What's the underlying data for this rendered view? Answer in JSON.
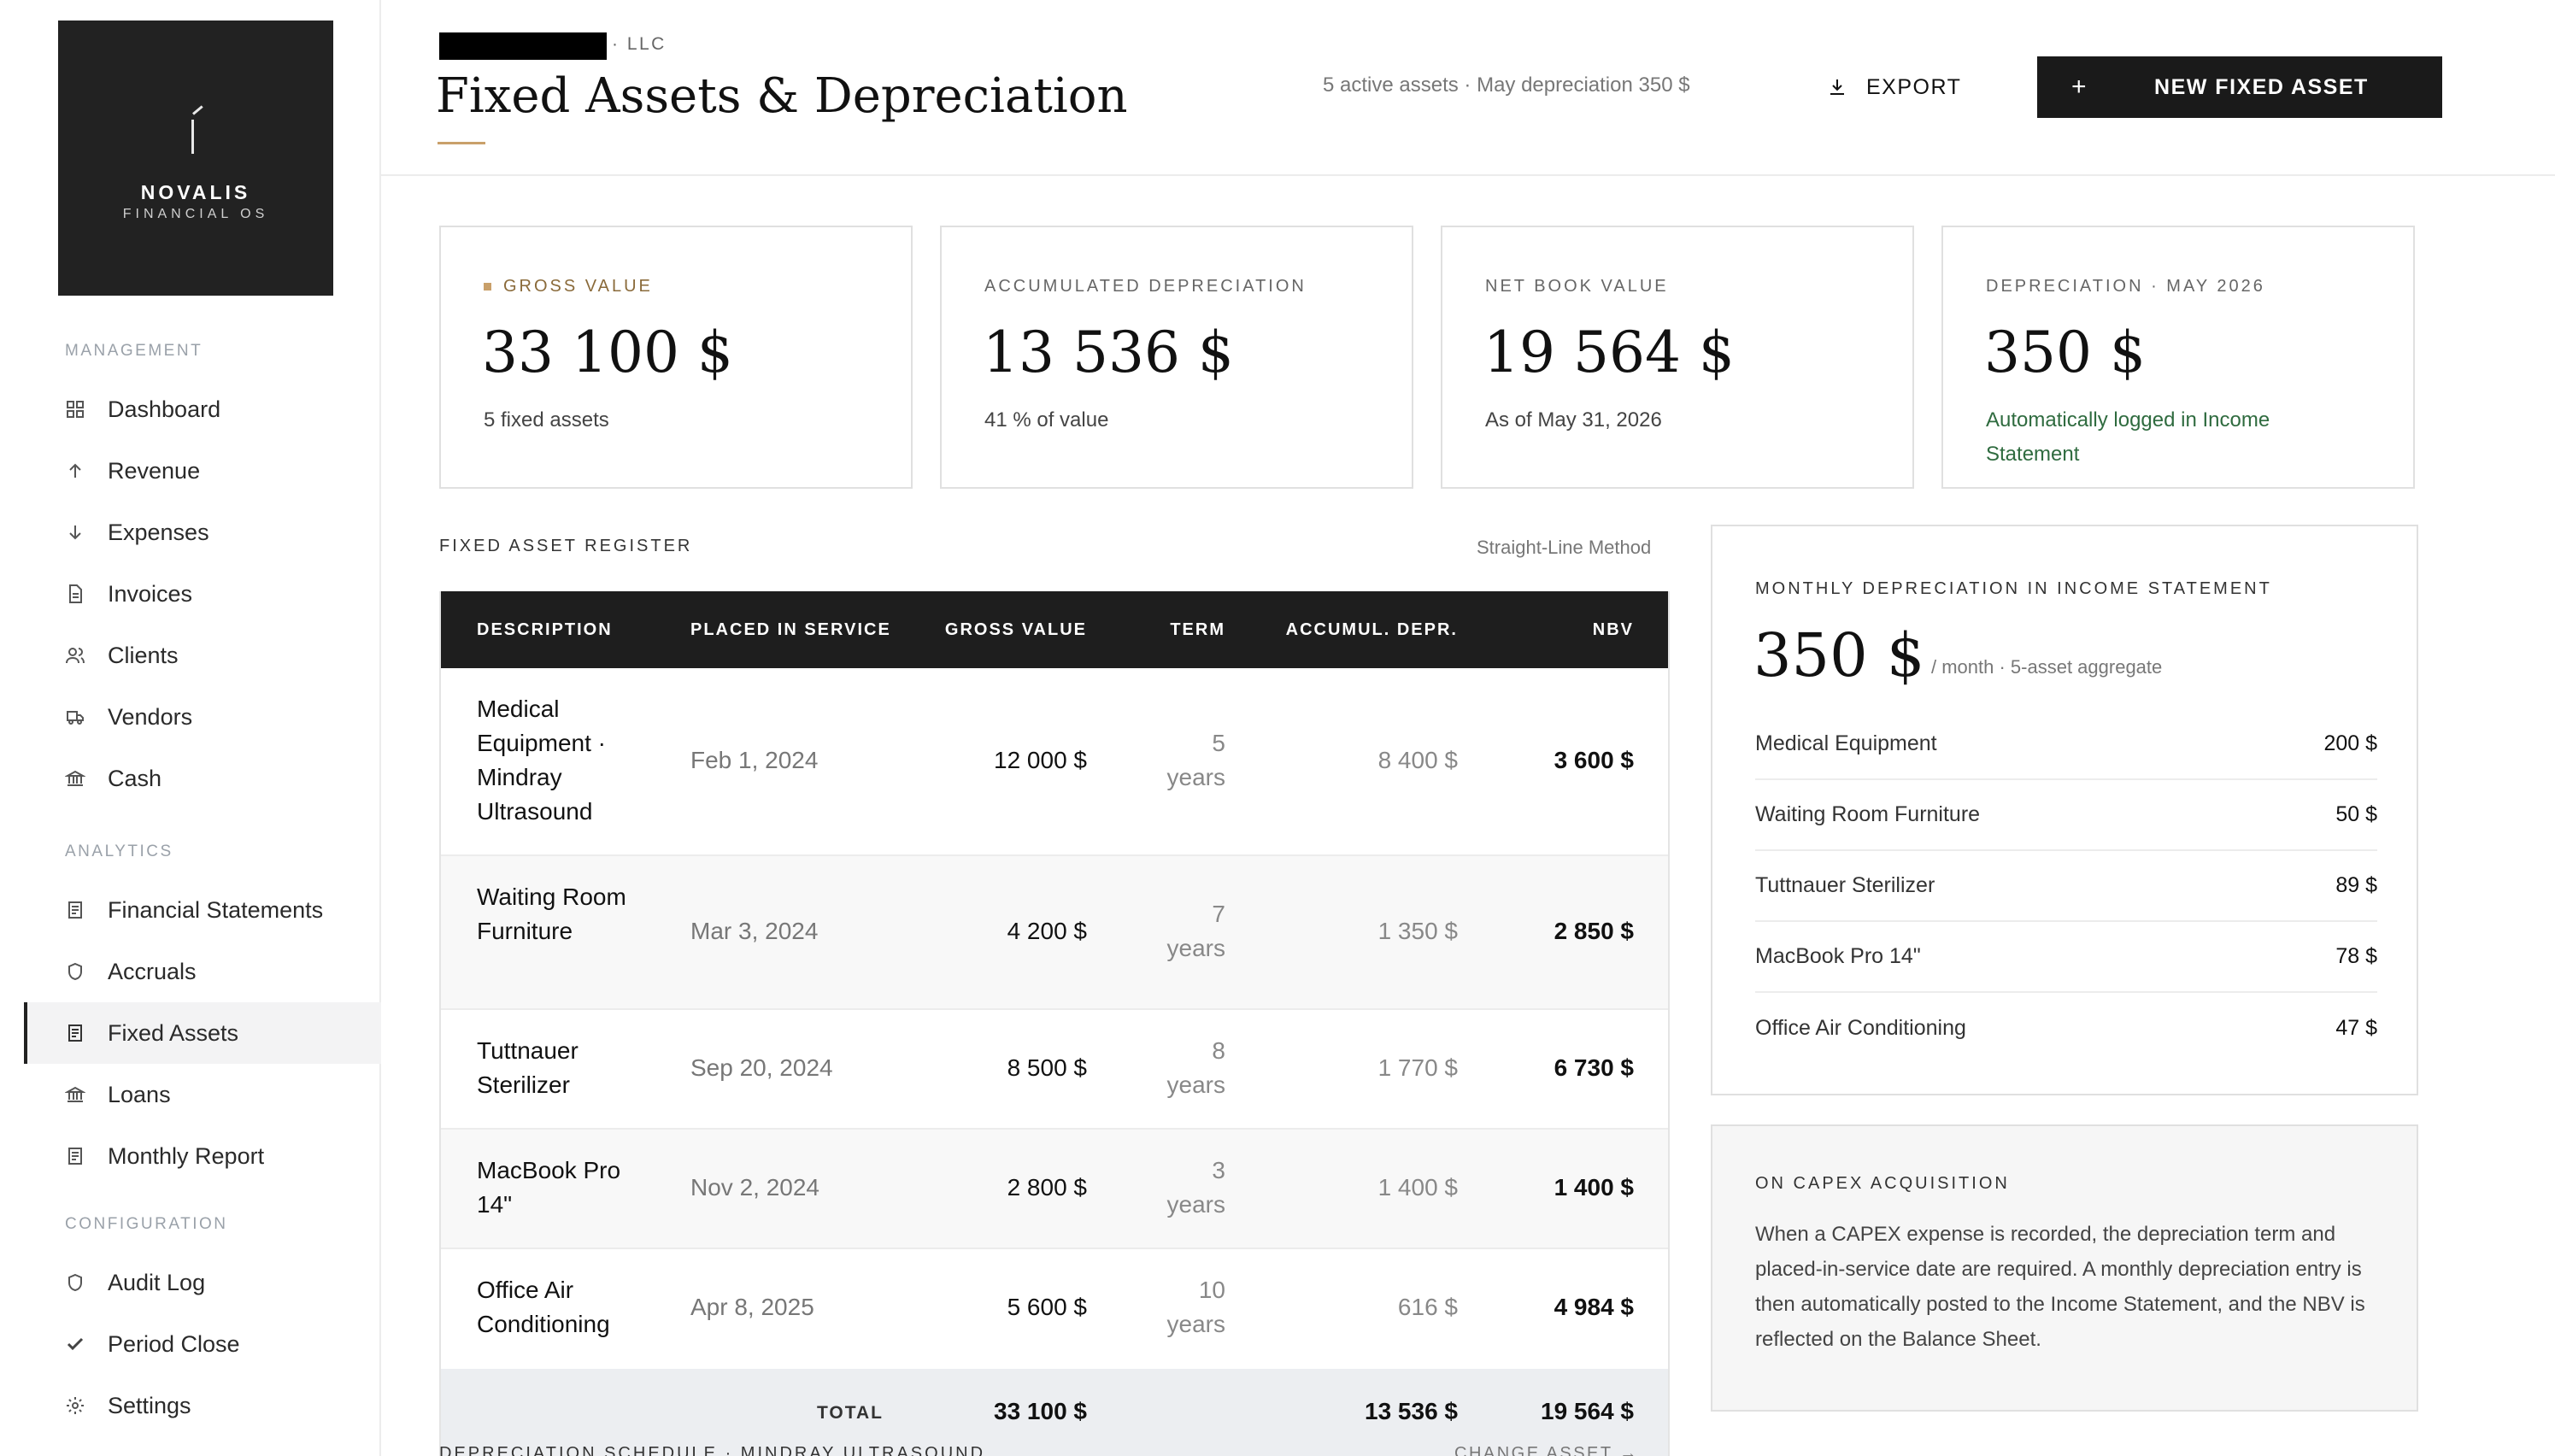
{
  "brand": {
    "name": "NOVALIS",
    "subtitle": "FINANCIAL OS"
  },
  "sidebar": {
    "sections": [
      {
        "label": "MANAGEMENT"
      },
      {
        "label": "ANALYTICS"
      },
      {
        "label": "CONFIGURATION"
      }
    ],
    "items": [
      {
        "label": "Dashboard",
        "icon": "grid-icon"
      },
      {
        "label": "Revenue",
        "icon": "arrow-up-icon"
      },
      {
        "label": "Expenses",
        "icon": "arrow-down-icon"
      },
      {
        "label": "Invoices",
        "icon": "document-icon"
      },
      {
        "label": "Clients",
        "icon": "users-icon"
      },
      {
        "label": "Vendors",
        "icon": "truck-icon"
      },
      {
        "label": "Cash",
        "icon": "bank-icon"
      },
      {
        "label": "Financial Statements",
        "icon": "report-icon"
      },
      {
        "label": "Accruals",
        "icon": "shield-icon"
      },
      {
        "label": "Fixed Assets",
        "icon": "report-icon",
        "active": true
      },
      {
        "label": "Loans",
        "icon": "bank-icon"
      },
      {
        "label": "Monthly Report",
        "icon": "report-icon"
      },
      {
        "label": "Audit Log",
        "icon": "shield-icon"
      },
      {
        "label": "Period Close",
        "icon": "check-icon"
      },
      {
        "label": "Settings",
        "icon": "gear-icon"
      }
    ]
  },
  "header": {
    "entity_suffix": "· LLC",
    "title": "Fixed Assets & Depreciation",
    "summary": "5 active assets · May depreciation 350 $",
    "export_label": "EXPORT",
    "new_label": "NEW FIXED ASSET"
  },
  "kpis": [
    {
      "label": "GROSS VALUE",
      "value": "33 100 $",
      "sub": "5 fixed assets"
    },
    {
      "label": "ACCUMULATED DEPRECIATION",
      "value": "13 536 $",
      "sub": "41 % of value"
    },
    {
      "label": "NET BOOK VALUE",
      "value": "19 564 $",
      "sub": "As of May 31, 2026"
    },
    {
      "label": "DEPRECIATION · MAY 2026",
      "value": "350 $",
      "sub": "Automatically logged in Income Statement"
    }
  ],
  "register": {
    "title": "FIXED ASSET REGISTER",
    "method": "Straight-Line Method",
    "columns": [
      "DESCRIPTION",
      "PLACED IN SERVICE",
      "GROSS VALUE",
      "TERM",
      "ACCUMUL. DEPR.",
      "NBV"
    ],
    "rows": [
      {
        "desc": "Medical Equipment · Mindray Ultrasound",
        "date": "Feb 1, 2024",
        "gross": "12 000 $",
        "term": "5 years",
        "accum": "8 400 $",
        "nbv": "3 600 $"
      },
      {
        "desc": "Waiting Room Furniture",
        "date": "Mar 3, 2024",
        "gross": "4 200 $",
        "term": "7 years",
        "accum": "1 350 $",
        "nbv": "2 850 $"
      },
      {
        "desc": "Tuttnauer Sterilizer",
        "date": "Sep 20, 2024",
        "gross": "8 500 $",
        "term": "8 years",
        "accum": "1 770 $",
        "nbv": "6 730 $"
      },
      {
        "desc": "MacBook Pro 14\"",
        "date": "Nov 2, 2024",
        "gross": "2 800 $",
        "term": "3 years",
        "accum": "1 400 $",
        "nbv": "1 400 $"
      },
      {
        "desc": "Office Air Conditioning",
        "date": "Apr 8, 2025",
        "gross": "5 600 $",
        "term": "10 years",
        "accum": "616 $",
        "nbv": "4 984 $"
      }
    ],
    "total": {
      "label": "TOTAL",
      "gross": "33 100 $",
      "accum": "13 536 $",
      "nbv": "19 564 $"
    }
  },
  "schedule": {
    "title": "DEPRECIATION SCHEDULE · MINDRAY ULTRASOUND",
    "change_label": "CHANGE ASSET →"
  },
  "monthly": {
    "title": "MONTHLY DEPRECIATION IN INCOME STATEMENT",
    "value": "350 $",
    "unit": "/ month · 5-asset aggregate",
    "items": [
      {
        "name": "Medical Equipment",
        "amount": "200 $"
      },
      {
        "name": "Waiting Room Furniture",
        "amount": "50 $"
      },
      {
        "name": "Tuttnauer Sterilizer",
        "amount": "89 $"
      },
      {
        "name": "MacBook Pro 14\"",
        "amount": "78 $"
      },
      {
        "name": "Office Air Conditioning",
        "amount": "47 $"
      }
    ]
  },
  "capex": {
    "title": "ON CAPEX ACQUISITION",
    "text": "When a CAPEX expense is recorded, the depreciation term and placed-in-service date are required. A monthly depreciation entry is then automatically posted to the Income Statement, and the NBV is reflected on the Balance Sheet."
  },
  "colors": {
    "accent_gold": "#c9a06a",
    "dark": "#1e1e1e",
    "positive_green": "#2f6b3f"
  }
}
